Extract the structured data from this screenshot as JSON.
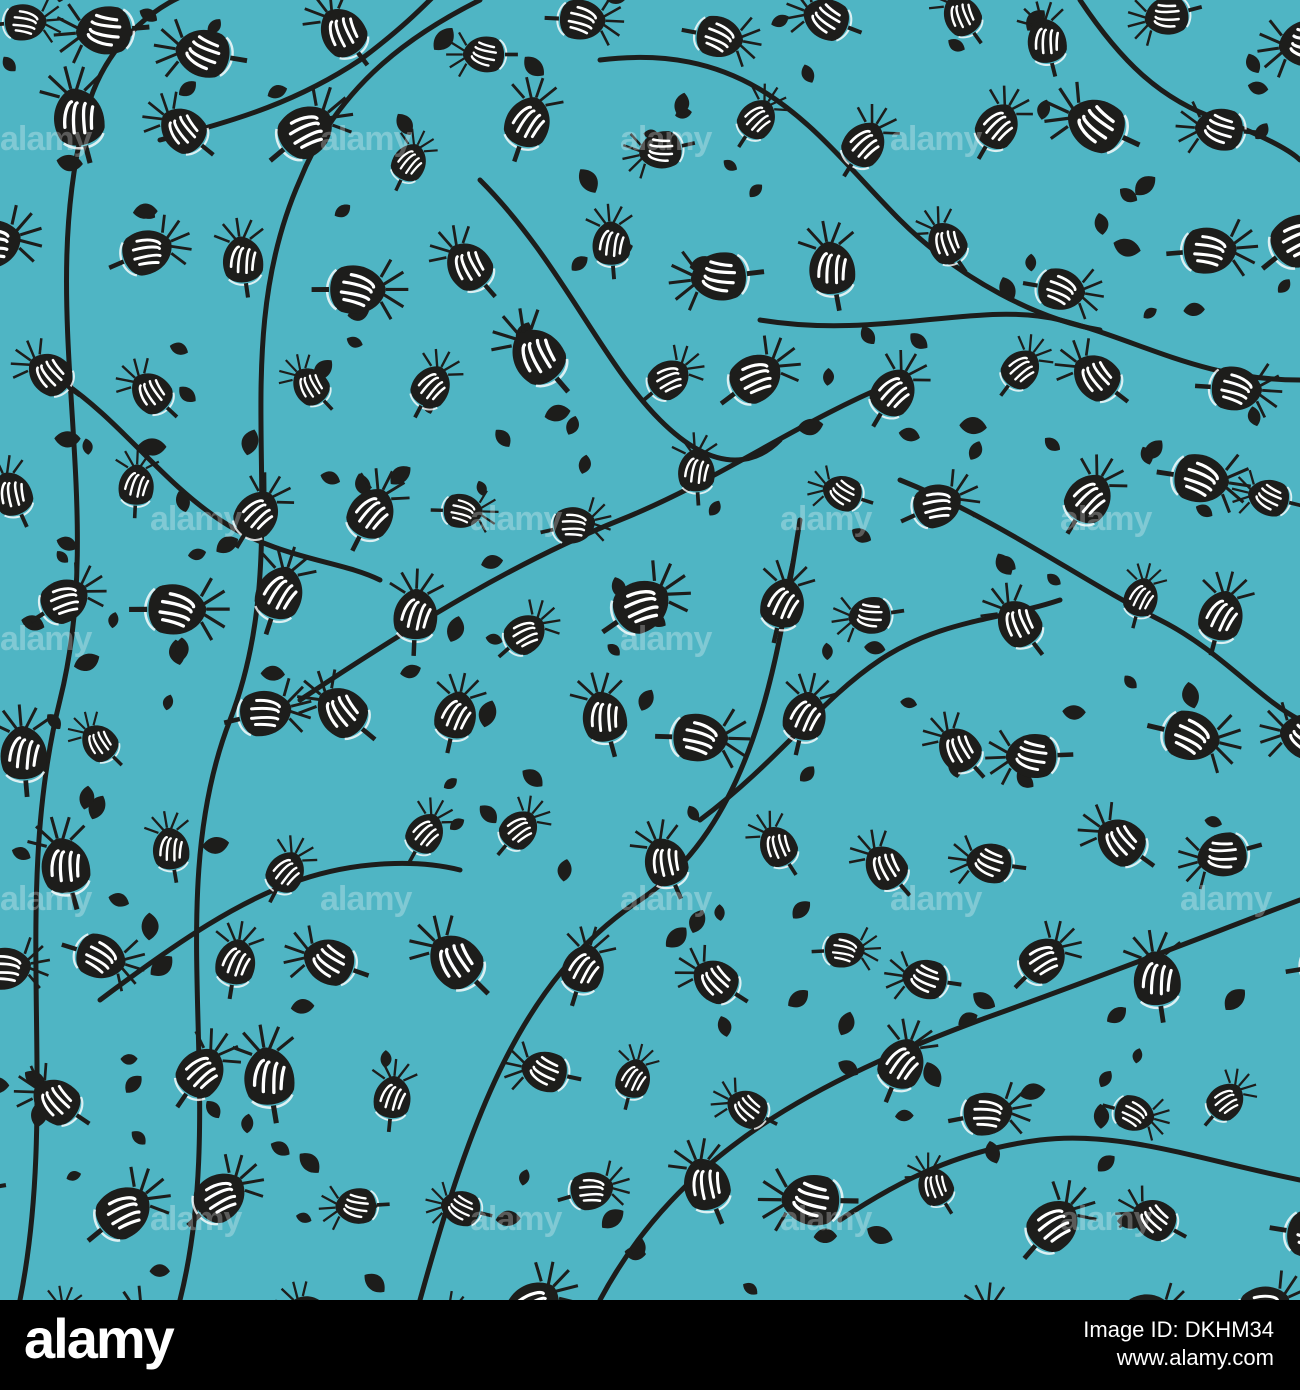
{
  "image": {
    "background_color": "#4fb5c4",
    "ink_color": "#1d1d1b",
    "highlight_color": "#ffffff"
  },
  "watermark": {
    "text": "alamy"
  },
  "footer": {
    "logo": "alamy",
    "image_id_label": "Image ID: DKHM34",
    "url": "www.alamy.com",
    "background": "#000000"
  }
}
